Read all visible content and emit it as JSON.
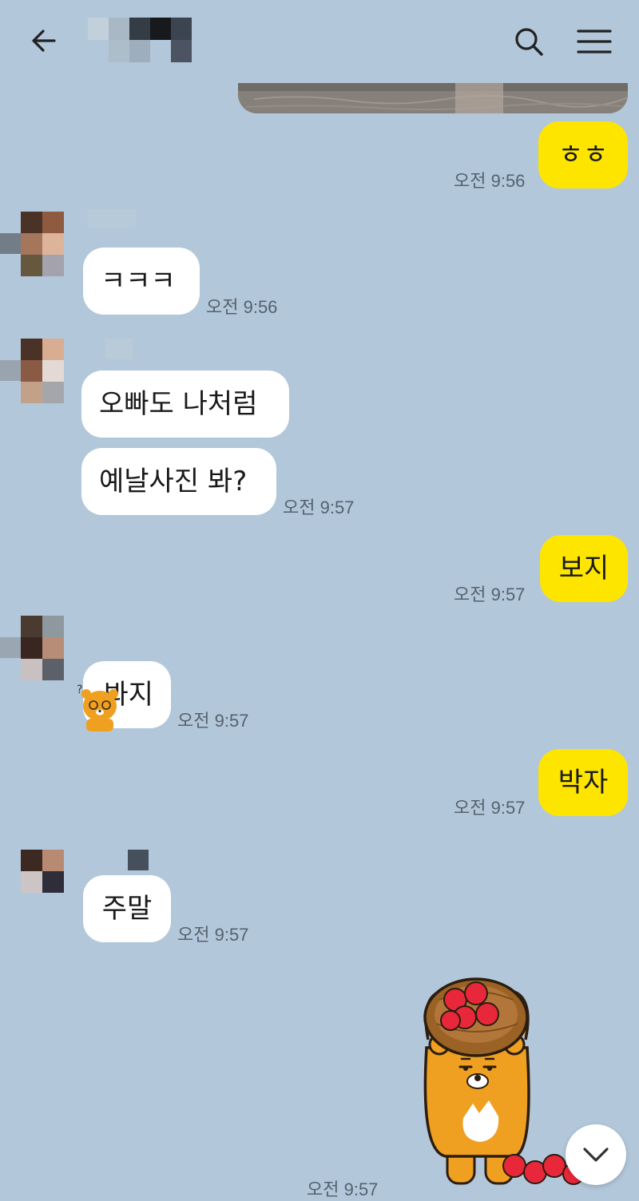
{
  "header": {
    "back_icon": "arrow-left-icon",
    "search_icon": "search-icon",
    "menu_icon": "hamburger-menu-icon"
  },
  "messages": [
    {
      "side": "out",
      "kind": "image",
      "label": ""
    },
    {
      "side": "out",
      "text": "ㅎㅎ",
      "time": "오전 9:56"
    },
    {
      "side": "in",
      "text": "ㅋㅋㅋ",
      "time": "오전 9:56"
    },
    {
      "side": "in",
      "text": "오빠도 나처럼"
    },
    {
      "side": "in",
      "text": "예날사진 봐?",
      "time": "오전 9:57"
    },
    {
      "side": "out",
      "text": "보지",
      "time": "오전 9:57"
    },
    {
      "side": "in",
      "text": "봐지",
      "time": "오전 9:57"
    },
    {
      "side": "out",
      "text": "박자",
      "time": "오전 9:57"
    },
    {
      "side": "in",
      "text": "주말",
      "time": "오전 9:57"
    },
    {
      "side": "out",
      "kind": "sticker",
      "time": "오전 9:57"
    }
  ],
  "colors": {
    "background": "#b2c7da",
    "incoming_bubble": "#ffffff",
    "outgoing_bubble": "#fee500"
  },
  "scroll_button_icon": "chevron-down-icon"
}
